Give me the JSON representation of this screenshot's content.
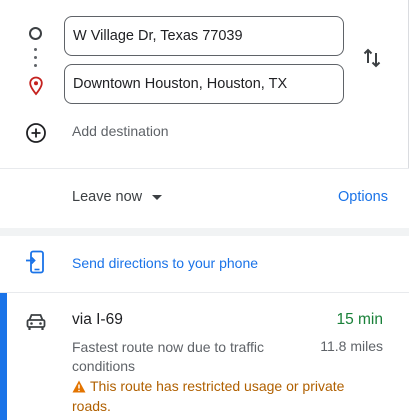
{
  "directions": {
    "origin": {
      "value": "W Village Dr, Texas 77039",
      "icon": "origin-circle-icon"
    },
    "destination": {
      "value": "Downtown Houston, Houston, TX",
      "icon": "destination-pin-icon"
    },
    "add_destination_label": "Add destination",
    "swap_icon": "swap-vertical-icon"
  },
  "depart": {
    "selected": "Leave now",
    "options_label": "Options"
  },
  "send_to_phone": {
    "label": "Send directions to your phone",
    "icon": "send-to-phone-icon"
  },
  "routes": [
    {
      "mode_icon": "car-icon",
      "name": "via I-69",
      "duration": "15 min",
      "distance": "11.8 miles",
      "description": "Fastest route now due to traffic conditions",
      "warning": "This route has restricted usage or private roads."
    }
  ],
  "colors": {
    "accent": "#1a73e8",
    "duration_green": "#188038",
    "warning": "#b06000",
    "pin_red": "#c5221f"
  }
}
